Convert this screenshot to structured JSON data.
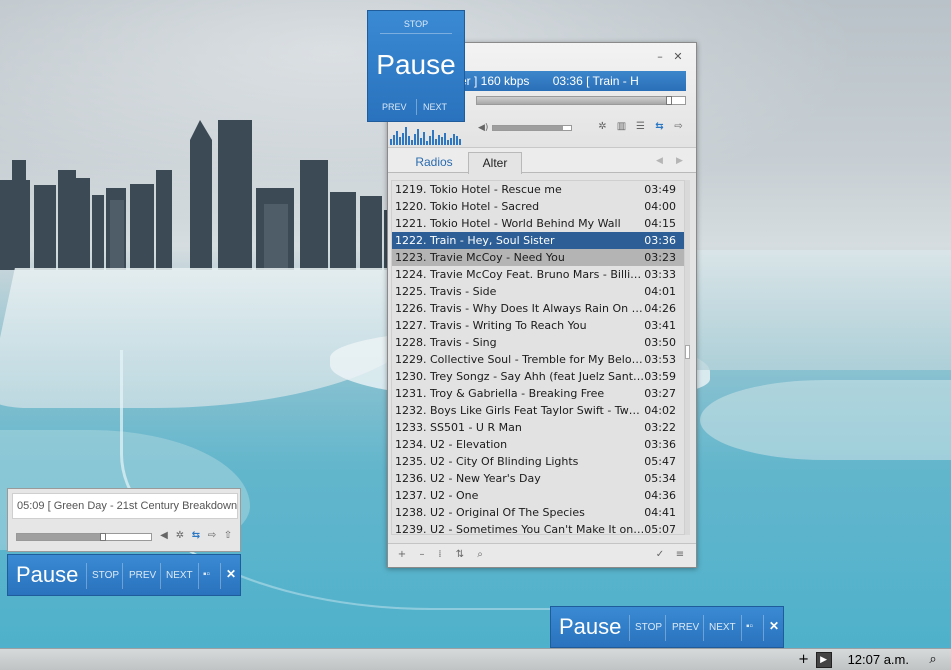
{
  "player": {
    "marquee_left": "ister ] 160 kbps",
    "marquee_right": "03:36 [ Train - H",
    "tabs": [
      "Radios",
      "Alter"
    ],
    "playlist": [
      {
        "title": "1219. Tokio Hotel - Rescue me",
        "duration": "03:49"
      },
      {
        "title": "1220. Tokio Hotel - Sacred",
        "duration": "04:00"
      },
      {
        "title": "1221. Tokio Hotel - World Behind My Wall",
        "duration": "04:15"
      },
      {
        "title": "1222. Train - Hey, Soul Sister",
        "duration": "03:36"
      },
      {
        "title": "1223. Travie McCoy - Need You",
        "duration": "03:23"
      },
      {
        "title": "1224. Travie McCoy Feat. Bruno Mars - Billionaire",
        "duration": "03:33"
      },
      {
        "title": "1225. Travis - Side",
        "duration": "04:01"
      },
      {
        "title": "1226. Travis - Why Does It Always Rain On Me",
        "duration": "04:26"
      },
      {
        "title": "1227. Travis - Writing To Reach You",
        "duration": "03:41"
      },
      {
        "title": "1228. Travis - Sing",
        "duration": "03:50"
      },
      {
        "title": "1229. Collective Soul - Tremble for My Beloved",
        "duration": "03:53"
      },
      {
        "title": "1230. Trey Songz - Say Ahh (feat Juelz Santana ...",
        "duration": "03:59"
      },
      {
        "title": "1231. Troy & Gabriella - Breaking Free",
        "duration": "03:27"
      },
      {
        "title": "1232. Boys Like Girls Feat Taylor Swift - Two Is ...",
        "duration": "04:02"
      },
      {
        "title": "1233. SS501 - U R Man",
        "duration": "03:22"
      },
      {
        "title": "1234. U2 - Elevation",
        "duration": "03:36"
      },
      {
        "title": "1235. U2 - City Of Blinding Lights",
        "duration": "05:47"
      },
      {
        "title": "1236. U2 - New Year's Day",
        "duration": "05:34"
      },
      {
        "title": "1237. U2 - One",
        "duration": "04:36"
      },
      {
        "title": "1238. U2 - Original Of The Species",
        "duration": "04:41"
      },
      {
        "title": "1239. U2 - Sometimes You Can't Make It on Yo...",
        "duration": "05:07"
      }
    ],
    "active_index": 3,
    "hover_index": 4,
    "seek_progress": 0.93,
    "volume_level": 0.9
  },
  "big_pause": {
    "stop": "STOP",
    "pause": "Pause",
    "prev": "PREV",
    "next": "NEXT"
  },
  "mini": {
    "track": "05:09 [ Green Day - 21st Century Breakdown",
    "progress": 0.64
  },
  "strip1": {
    "pause": "Pause",
    "stop": "STOP",
    "prev": "PREV",
    "next": "NEXT"
  },
  "strip2": {
    "pause": "Pause",
    "stop": "STOP",
    "prev": "PREV",
    "next": "NEXT"
  },
  "taskbar": {
    "clock": "12:07 a.m."
  },
  "colors": {
    "accent": "#2a72bd",
    "active_row": "#2d5f96",
    "hover_row": "#b4b4b4"
  }
}
